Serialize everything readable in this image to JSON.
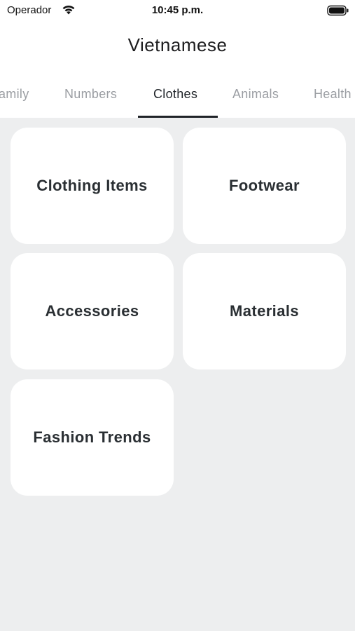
{
  "status_bar": {
    "carrier": "Operador",
    "time": "10:45 p.m."
  },
  "header": {
    "title": "Vietnamese"
  },
  "tabs": [
    {
      "label": "amily"
    },
    {
      "label": "Numbers"
    },
    {
      "label": "Clothes",
      "active": true
    },
    {
      "label": "Animals"
    },
    {
      "label": "Health"
    }
  ],
  "categories": [
    {
      "label": "Clothing Items"
    },
    {
      "label": "Footwear"
    },
    {
      "label": "Accessories"
    },
    {
      "label": "Materials"
    },
    {
      "label": "Fashion Trends"
    }
  ],
  "icons": {
    "wifi": "wifi-icon",
    "battery": "battery-icon"
  },
  "colors": {
    "background": "#edeeef",
    "card": "#ffffff",
    "active_tab": "#1f2328",
    "inactive_tab": "#9b9ea3"
  }
}
